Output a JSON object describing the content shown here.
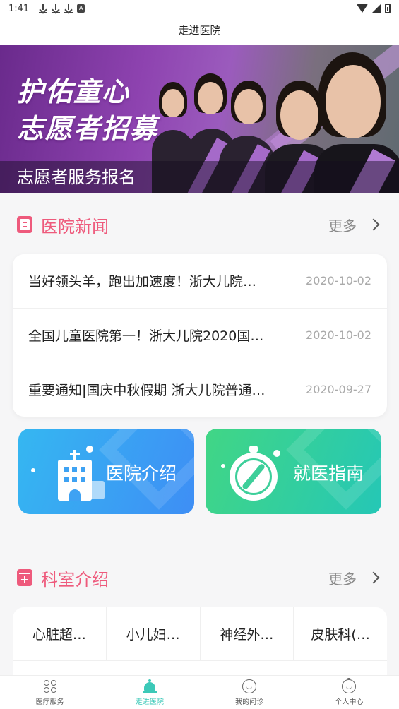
{
  "status_bar": {
    "time": "1:41"
  },
  "header": {
    "title": "走进医院"
  },
  "banner": {
    "title_line1": "护佑童心",
    "title_line2": "志愿者招募",
    "caption": "志愿者服务报名"
  },
  "news": {
    "title": "医院新闻",
    "more_label": "更多",
    "items": [
      {
        "title": "当好领头羊，跑出加速度！浙大儿院…",
        "date": "2020-10-02"
      },
      {
        "title": "全国儿童医院第一！浙大儿院2020国…",
        "date": "2020-10-02"
      },
      {
        "title": "重要通知|国庆中秋假期 浙大儿院普通…",
        "date": "2020-09-27"
      }
    ]
  },
  "tiles": {
    "hospital_intro": "医院介绍",
    "guide": "就医指南"
  },
  "departments": {
    "title": "科室介绍",
    "more_label": "更多",
    "items": [
      "心脏超…",
      "小儿妇…",
      "神经外…",
      "皮肤科(…"
    ]
  },
  "tab_bar": {
    "items": [
      {
        "label": "医疗服务",
        "icon": "grid-icon"
      },
      {
        "label": "走进医院",
        "icon": "hospital-bell-icon"
      },
      {
        "label": "我的问诊",
        "icon": "smile-icon"
      },
      {
        "label": "个人中心",
        "icon": "user-icon"
      }
    ],
    "active_color": "#3cc9b8"
  },
  "colors": {
    "accent_pink": "#ee5a7c",
    "blue_tile": "#3e8ef5",
    "green_tile": "#25c7b6"
  }
}
